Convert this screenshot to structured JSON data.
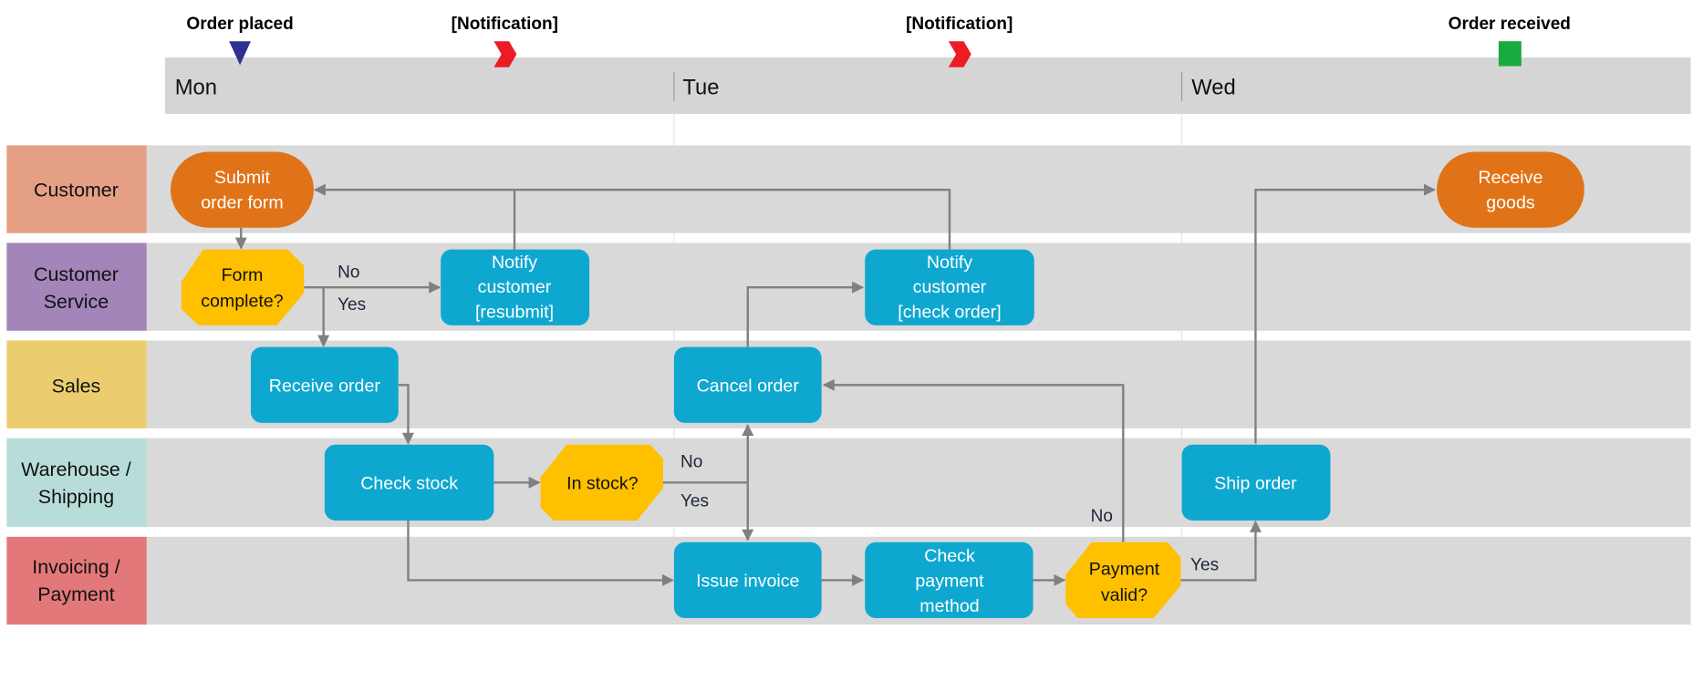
{
  "milestones": [
    {
      "label": "Order placed",
      "marker": "triangle-down-icon",
      "color": "#2e3192"
    },
    {
      "label": "[Notification]",
      "marker": "chevron-right-icon",
      "color": "#ed1c24"
    },
    {
      "label": "[Notification]",
      "marker": "chevron-right-icon",
      "color": "#ed1c24"
    },
    {
      "label": "Order received",
      "marker": "square-icon",
      "color": "#1aab40"
    }
  ],
  "days": [
    "Mon",
    "Tue",
    "Wed"
  ],
  "lanes": [
    {
      "label": [
        "Customer"
      ],
      "color": "#e59f85"
    },
    {
      "label": [
        "Customer",
        "Service"
      ],
      "color": "#a385b9"
    },
    {
      "label": [
        "Sales"
      ],
      "color": "#ebcd6f"
    },
    {
      "label": [
        "Warehouse /",
        "Shipping"
      ],
      "color": "#b8ddd9"
    },
    {
      "label": [
        "Invoicing /",
        "Payment"
      ],
      "color": "#e3787a"
    }
  ],
  "colors": {
    "lane_bg": "#d9d9d9",
    "header_bg": "#d5d5d5",
    "terminal": "#e07318",
    "process": "#0ea7d0",
    "decision": "#ffc000",
    "connector": "#808080"
  },
  "nodes": {
    "submit_order_form": [
      "Submit",
      "order form"
    ],
    "form_complete": [
      "Form",
      "complete?"
    ],
    "notify_resubmit": [
      "Notify",
      "customer",
      "[resubmit]"
    ],
    "notify_check_order": [
      "Notify",
      "customer",
      "[check order]"
    ],
    "receive_order": [
      "Receive order"
    ],
    "cancel_order": [
      "Cancel order"
    ],
    "check_stock": [
      "Check stock"
    ],
    "in_stock": [
      "In stock?"
    ],
    "ship_order": [
      "Ship order"
    ],
    "issue_invoice": [
      "Issue invoice"
    ],
    "check_payment_method": [
      "Check",
      "payment",
      "method"
    ],
    "payment_valid": [
      "Payment",
      "valid?"
    ],
    "receive_goods": [
      "Receive",
      "goods"
    ]
  },
  "edge_labels": {
    "form_no": "No",
    "form_yes": "Yes",
    "stock_no": "No",
    "stock_yes": "Yes",
    "payment_no": "No",
    "payment_yes": "Yes"
  }
}
